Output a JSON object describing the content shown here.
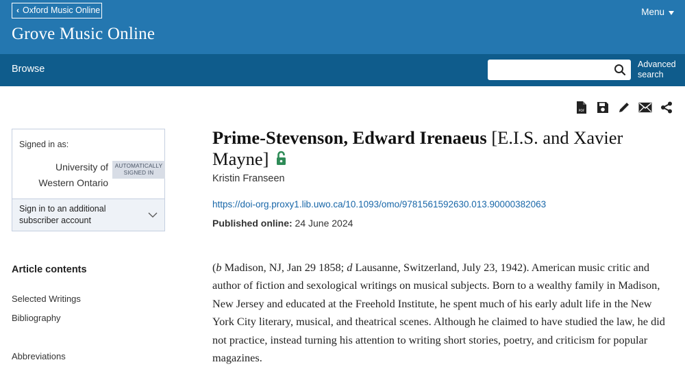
{
  "header": {
    "back_link": "Oxford Music Online",
    "site_title": "Grove Music Online",
    "menu_label": "Menu"
  },
  "nav": {
    "browse_label": "Browse",
    "search_placeholder": "",
    "advanced_search_line1": "Advanced",
    "advanced_search_line2": "search"
  },
  "toolbar": {
    "icons": [
      "pdf-icon",
      "save-icon",
      "edit-icon",
      "email-icon",
      "share-icon"
    ]
  },
  "signin": {
    "signed_in_as": "Signed in as:",
    "institution_line1": "University of",
    "institution_line2": "Western Ontario",
    "badge_line1": "AUTOMATICALLY",
    "badge_line2": "SIGNED IN",
    "additional_line1": "Sign in to an additional",
    "additional_line2": "subscriber account"
  },
  "contents": {
    "title": "Article contents",
    "items": [
      "Selected Writings",
      "Bibliography",
      "Abbreviations"
    ]
  },
  "article": {
    "title_main": "Prime-Stevenson, Edward Irenaeus",
    "title_alias": " [E.I.S. and Xavier Mayne]",
    "author": "Kristin Franseen",
    "doi": "https://doi-org.proxy1.lib.uwo.ca/10.1093/omo/9781561592630.013.90000382063",
    "published_label": "Published online:",
    "published_date": " 24 June 2024",
    "intro_open": "(",
    "intro_b": "b",
    "intro_birth": " Madison, NJ, Jan 29 1858; ",
    "intro_d": "d",
    "intro_rest": " Lausanne, Switzerland, July 23, 1942). American music critic and author of fiction and sexological writings on musical subjects. Born to a wealthy family in Madison, New Jersey and educated at the Freehold Institute, he spent much of his early adult life in the New York City literary, musical, and theatrical scenes. Although he claimed to have studied the law, he did not practice, instead turning his attention to writing short stories, poetry, and criticism for popular magazines."
  },
  "colors": {
    "topbar": "#2477b0",
    "navbar": "#0f5c8c",
    "link": "#1766a8",
    "lock_green": "#2e8b57"
  }
}
